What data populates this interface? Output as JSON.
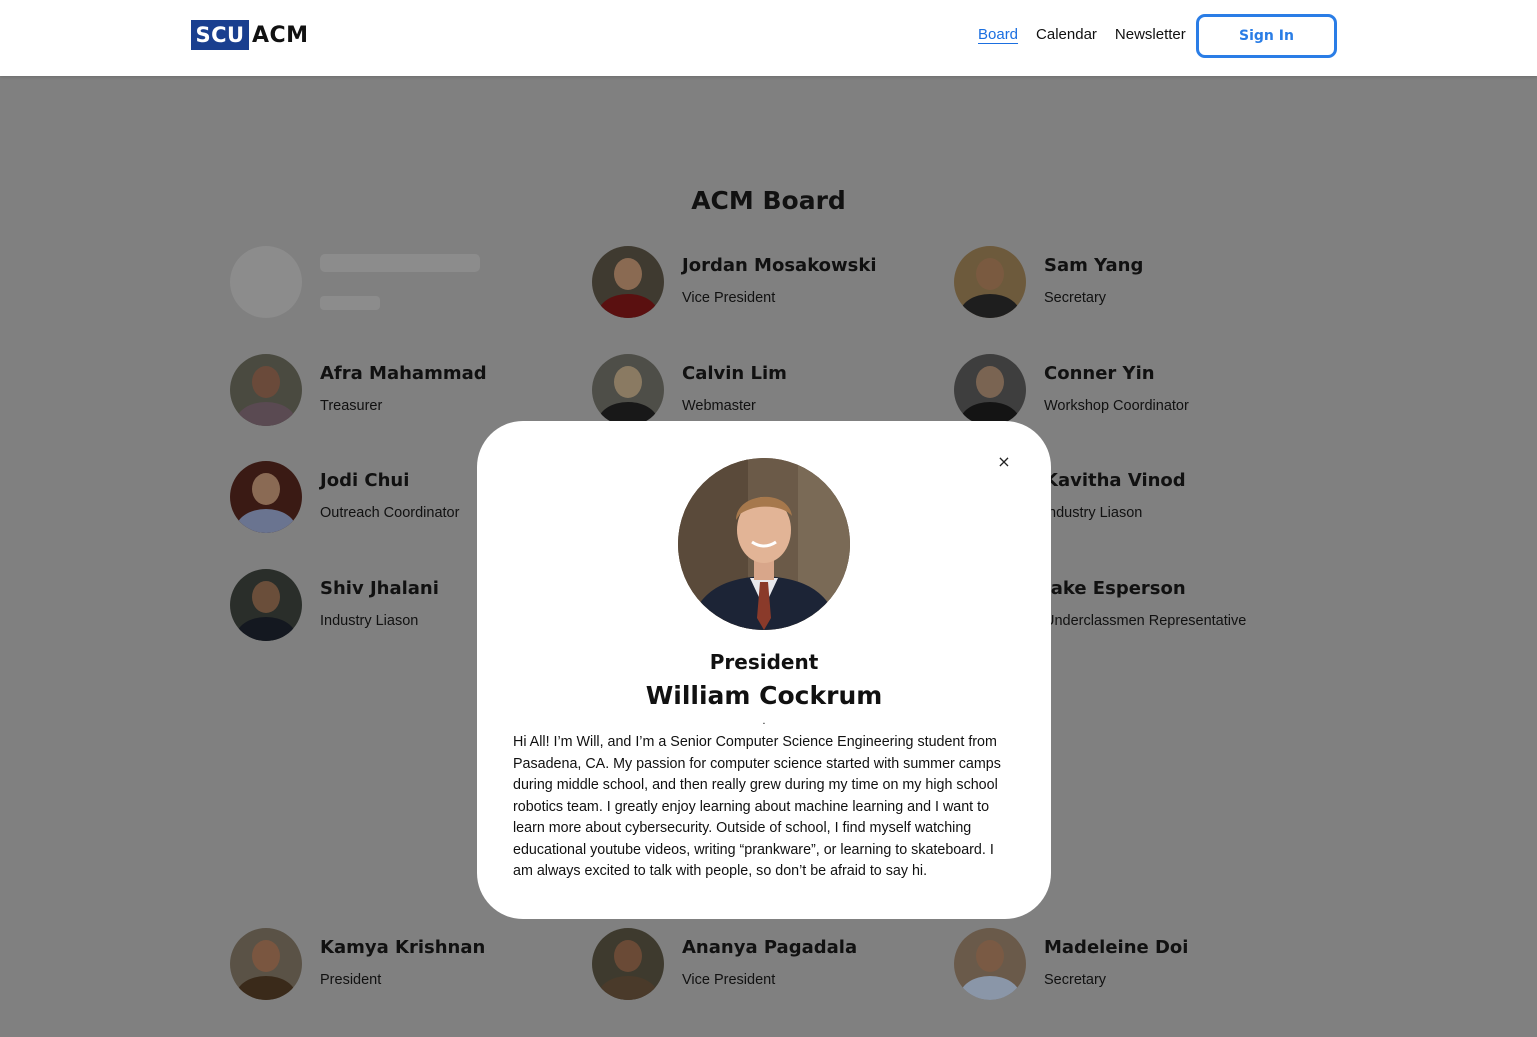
{
  "header": {
    "logo_box": "SCU",
    "logo_text": "ACM",
    "nav": [
      {
        "label": "Board",
        "active": true
      },
      {
        "label": "Calendar",
        "active": false
      },
      {
        "label": "Newsletter",
        "active": false
      }
    ],
    "signin_label": "Sign In"
  },
  "page": {
    "title": "ACM Board",
    "members": [
      {
        "name": "Jordan Mosakowski",
        "role": "Vice President"
      },
      {
        "name": "Sam Yang",
        "role": "Secretary"
      },
      {
        "name": "Afra Mahammad",
        "role": "Treasurer"
      },
      {
        "name": "Calvin Lim",
        "role": "Webmaster"
      },
      {
        "name": "Conner Yin",
        "role": "Workshop Coordinator"
      },
      {
        "name": "Jodi Chui",
        "role": "Outreach Coordinator"
      },
      {
        "name": "Kavitha Vinod",
        "role": "Industry Liason"
      },
      {
        "name": "Shiv Jhalani",
        "role": "Industry Liason"
      },
      {
        "name": "Jake Esperson",
        "role": "Underclassmen Representative"
      },
      {
        "name": "Kamya Krishnan",
        "role": "President"
      },
      {
        "name": "Ananya Pagadala",
        "role": "Vice President"
      },
      {
        "name": "Madeleine Doi",
        "role": "Secretary"
      }
    ]
  },
  "modal": {
    "close_icon": "×",
    "role": "President",
    "name": "William Cockrum",
    "dot": ".",
    "bio": "Hi All! I’m Will, and I’m a Senior Computer Science Engineering student from Pasadena, CA. My passion for computer science started with summer camps during middle school, and then really grew during my time on my high school robotics team. I greatly enjoy learning about machine learning and I want to learn more about cybersecurity. Outside of school, I find myself watching educational youtube videos, writing “prankware”, or learning to skateboard. I am always excited to talk with people, so don’t be afraid to say hi."
  },
  "colors": {
    "brand": "#1a3f8f",
    "accent": "#2a7de6",
    "overlay": "#808080"
  }
}
